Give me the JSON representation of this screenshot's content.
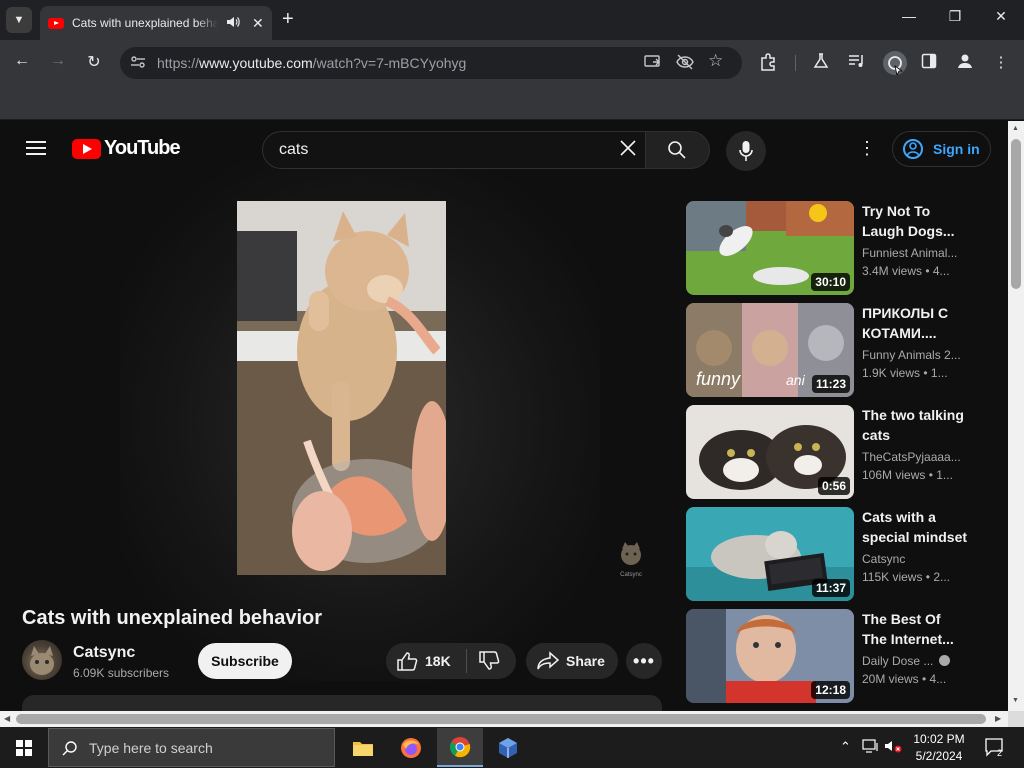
{
  "browser": {
    "tab_title": "Cats with unexplained behavior - YouTube",
    "url_prefix": "https://",
    "url_host": "www.youtube.com",
    "url_path": "/watch?v=7-mBCYyohyg"
  },
  "youtube": {
    "logo_text": "YouTube",
    "search_query": "cats",
    "signin_label": "Sign in"
  },
  "video": {
    "title": "Cats with unexplained behavior",
    "channel": "Catsync",
    "subscribers": "6.09K subscribers",
    "subscribe_label": "Subscribe",
    "likes": "18K",
    "share_label": "Share",
    "watermark_text": "Catsync"
  },
  "recommendations": [
    {
      "title_l1": "Try Not To",
      "title_l2": "Laugh Dogs...",
      "channel": "Funniest Animal...",
      "meta": "3.4M views  • 4...",
      "duration": "30:10"
    },
    {
      "title_l1": "ПРИКОЛЫ С",
      "title_l2": "КОТАМИ....",
      "channel": "Funny Animals 2...",
      "meta": "1.9K views  • 1...",
      "duration": "11:23",
      "thumb_text": "funny",
      "thumb_text2": "ani"
    },
    {
      "title_l1": "The two talking",
      "title_l2": "cats",
      "channel": "TheCatsPyjaaaa...",
      "meta": "106M views  • 1...",
      "duration": "0:56"
    },
    {
      "title_l1": "Cats with a",
      "title_l2": "special mindset",
      "channel": "Catsync",
      "meta": "115K views  • 2...",
      "duration": "11:37"
    },
    {
      "title_l1": "The Best Of",
      "title_l2": "The Internet...",
      "channel": "Daily Dose ...",
      "meta": "20M views  • 4...",
      "duration": "12:18"
    }
  ],
  "taskbar": {
    "search_placeholder": "Type here to search",
    "time": "10:02 PM",
    "date": "5/2/2024",
    "notification_count": "2"
  },
  "colors": {
    "youtube_red": "#ff0000",
    "link_blue": "#3ea6ff",
    "page_bg": "#0f0f0f"
  }
}
